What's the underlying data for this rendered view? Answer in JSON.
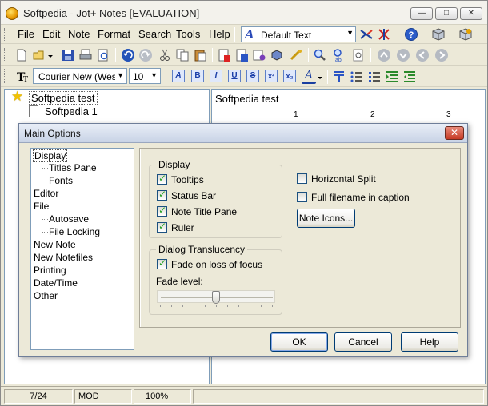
{
  "window": {
    "title": "Softpedia - Jot+ Notes [EVALUATION]",
    "controls": {
      "minimize": "—",
      "maximize": "□",
      "close": "✕"
    }
  },
  "menu": [
    "File",
    "Edit",
    "Note",
    "Format",
    "Search",
    "Tools",
    "Help"
  ],
  "style_combo": {
    "icon": "A",
    "value": "Default Text"
  },
  "toolbar_icons": [
    "new-icon",
    "open-icon",
    "save-icon",
    "print-icon",
    "preview-icon",
    "undo-icon",
    "redo-icon",
    "cut-icon",
    "copy-icon",
    "paste-icon",
    "add-note-icon",
    "delete-note-icon",
    "properties-icon",
    "encrypt-icon",
    "link-icon",
    "find-icon",
    "replace-icon",
    "find-next-icon",
    "nav-up-icon",
    "nav-down-icon",
    "nav-back-icon",
    "nav-forward-icon"
  ],
  "format_bar": {
    "font": "Courier New (Weste",
    "size": "10",
    "buttons": [
      "A",
      "B",
      "I",
      "U",
      "S",
      "x²",
      "x₂",
      "A"
    ]
  },
  "tree": {
    "root": "Softpedia test",
    "children": [
      "Softpedia 1"
    ]
  },
  "note_pane": {
    "title": "Softpedia test",
    "ruler_numbers": [
      "1",
      "2",
      "3"
    ]
  },
  "statusbar": {
    "position": "7/24",
    "mode": "MOD",
    "zoom": "100%"
  },
  "dialog": {
    "title": "Main Options",
    "close": "✕",
    "tree": [
      {
        "label": "Display",
        "level": 0,
        "selected": true
      },
      {
        "label": "Titles Pane",
        "level": 1
      },
      {
        "label": "Fonts",
        "level": 1
      },
      {
        "label": "Editor",
        "level": 0
      },
      {
        "label": "File",
        "level": 0
      },
      {
        "label": "Autosave",
        "level": 1
      },
      {
        "label": "File Locking",
        "level": 1
      },
      {
        "label": "New Note",
        "level": 0
      },
      {
        "label": "New Notefiles",
        "level": 0
      },
      {
        "label": "Printing",
        "level": 0
      },
      {
        "label": "Date/Time",
        "level": 0
      },
      {
        "label": "Other",
        "level": 0
      }
    ],
    "display_group": {
      "title": "Display",
      "options": [
        {
          "label": "Tooltips",
          "checked": true
        },
        {
          "label": "Status Bar",
          "checked": true
        },
        {
          "label": "Note Title Pane",
          "checked": true
        },
        {
          "label": "Ruler",
          "checked": true
        }
      ]
    },
    "right_options": [
      {
        "label": "Horizontal Split",
        "checked": false
      },
      {
        "label": "Full filename in caption",
        "checked": false
      }
    ],
    "note_icons_button": "Note Icons...",
    "translucency_group": {
      "title": "Dialog Translucency",
      "fade_label": "Fade on loss of focus",
      "fade_checked": true,
      "fade_level_label": "Fade level:",
      "fade_level": 0.5
    },
    "buttons": {
      "ok": "OK",
      "cancel": "Cancel",
      "help": "Help"
    }
  }
}
